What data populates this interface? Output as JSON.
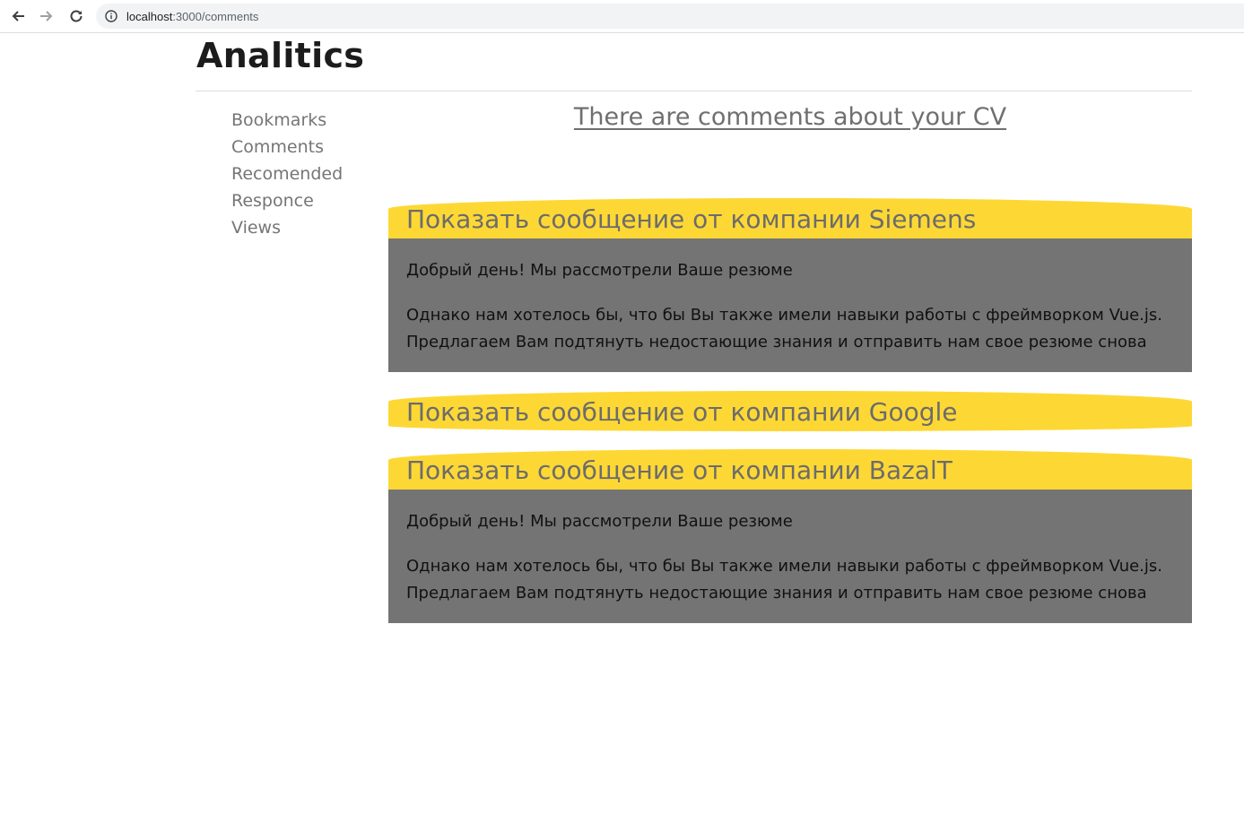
{
  "browser": {
    "url_host": "localhost",
    "url_path": ":3000/comments"
  },
  "page": {
    "title": "Analitics"
  },
  "sidebar": {
    "items": [
      {
        "label": "Bookmarks"
      },
      {
        "label": "Comments"
      },
      {
        "label": "Recomended"
      },
      {
        "label": "Responce"
      },
      {
        "label": "Views"
      }
    ]
  },
  "main": {
    "heading": "There are comments about your CV",
    "messages": [
      {
        "header": "Показать сообщение от компании Siemens",
        "expanded": true,
        "greeting": "Добрый день! Мы рассмотрели Ваше резюме",
        "line1": "Однако нам хотелось бы, что бы Вы также имели навыки работы с фреймворком Vue.js.",
        "line2": "Предлагаем Вам подтянуть недостающие знания и отправить нам свое резюме снова"
      },
      {
        "header": "Показать сообщение от компании Google",
        "expanded": false
      },
      {
        "header": "Показать сообщение от компании BazalT",
        "expanded": true,
        "greeting": "Добрый день! Мы рассмотрели Ваше резюме",
        "line1": "Однако нам хотелось бы, что бы Вы также имели навыки работы с фреймворком Vue.js.",
        "line2": "Предлагаем Вам подтянуть недостающие знания и отправить нам свое резюме снова"
      }
    ]
  },
  "colors": {
    "header_bg": "#fdd835",
    "body_bg": "#747474",
    "sidebar_text": "#757575"
  },
  "icons": {
    "back": "arrow-left-icon",
    "forward": "arrow-right-icon",
    "reload": "reload-icon",
    "info": "info-icon"
  }
}
